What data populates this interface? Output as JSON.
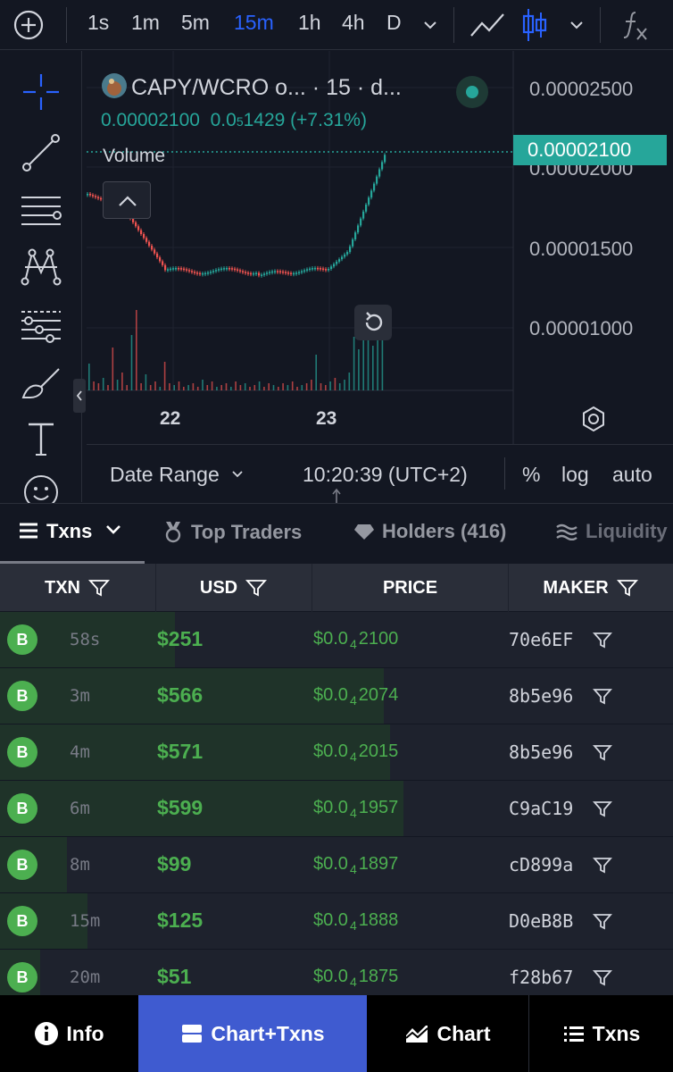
{
  "toolbar": {
    "timeframes": [
      "1s",
      "1m",
      "5m",
      "15m",
      "1h",
      "4h",
      "D"
    ],
    "active_timeframe": "15m"
  },
  "legend": {
    "pair": "CAPY/WCRO o... · 15 · d...",
    "price": "0.00002100",
    "change_prefix": "0.0",
    "change_sub": "5",
    "change_rest": "1429 (+7.31%)",
    "volume_label": "Volume"
  },
  "price_axis": {
    "labels": [
      "0.00002500",
      "0.00002000",
      "0.00001500",
      "0.00001000"
    ],
    "current": "0.00002100"
  },
  "time_axis": {
    "labels": [
      "22",
      "23"
    ]
  },
  "chart_bottom": {
    "date_range": "Date Range",
    "clock": "10:20:39 (UTC+2)",
    "percent": "%",
    "log": "log",
    "auto": "auto"
  },
  "tabs": {
    "txns": "Txns",
    "top_traders": "Top Traders",
    "holders": "Holders (416)",
    "liquidity": "Liquidity"
  },
  "table": {
    "headers": {
      "txn": "TXN",
      "usd": "USD",
      "price": "PRICE",
      "maker": "MAKER"
    },
    "rows": [
      {
        "type": "B",
        "age": "58s",
        "usd": "$251",
        "price_prefix": "$0.0",
        "price_sub": "4",
        "price_rest": "2100",
        "maker": "70e6EF",
        "fill": 0.26
      },
      {
        "type": "B",
        "age": "3m",
        "usd": "$566",
        "price_prefix": "$0.0",
        "price_sub": "4",
        "price_rest": "2074",
        "maker": "8b5e96",
        "fill": 0.57
      },
      {
        "type": "B",
        "age": "4m",
        "usd": "$571",
        "price_prefix": "$0.0",
        "price_sub": "4",
        "price_rest": "2015",
        "maker": "8b5e96",
        "fill": 0.58
      },
      {
        "type": "B",
        "age": "6m",
        "usd": "$599",
        "price_prefix": "$0.0",
        "price_sub": "4",
        "price_rest": "1957",
        "maker": "C9aC19",
        "fill": 0.6
      },
      {
        "type": "B",
        "age": "8m",
        "usd": "$99",
        "price_prefix": "$0.0",
        "price_sub": "4",
        "price_rest": "1897",
        "maker": "cD899a",
        "fill": 0.1
      },
      {
        "type": "B",
        "age": "15m",
        "usd": "$125",
        "price_prefix": "$0.0",
        "price_sub": "4",
        "price_rest": "1888",
        "maker": "D0eB8B",
        "fill": 0.13
      },
      {
        "type": "B",
        "age": "20m",
        "usd": "$51",
        "price_prefix": "$0.0",
        "price_sub": "4",
        "price_rest": "1875",
        "maker": "f28b67",
        "fill": 0.06
      }
    ]
  },
  "bottom_nav": {
    "info": "Info",
    "chart_txns": "Chart+Txns",
    "chart": "Chart",
    "txns": "Txns"
  },
  "colors": {
    "up": "#26a69a",
    "down": "#ef5350",
    "active": "#2962ff",
    "nav_active": "#3f5bd0",
    "buy": "#4caf50"
  }
}
